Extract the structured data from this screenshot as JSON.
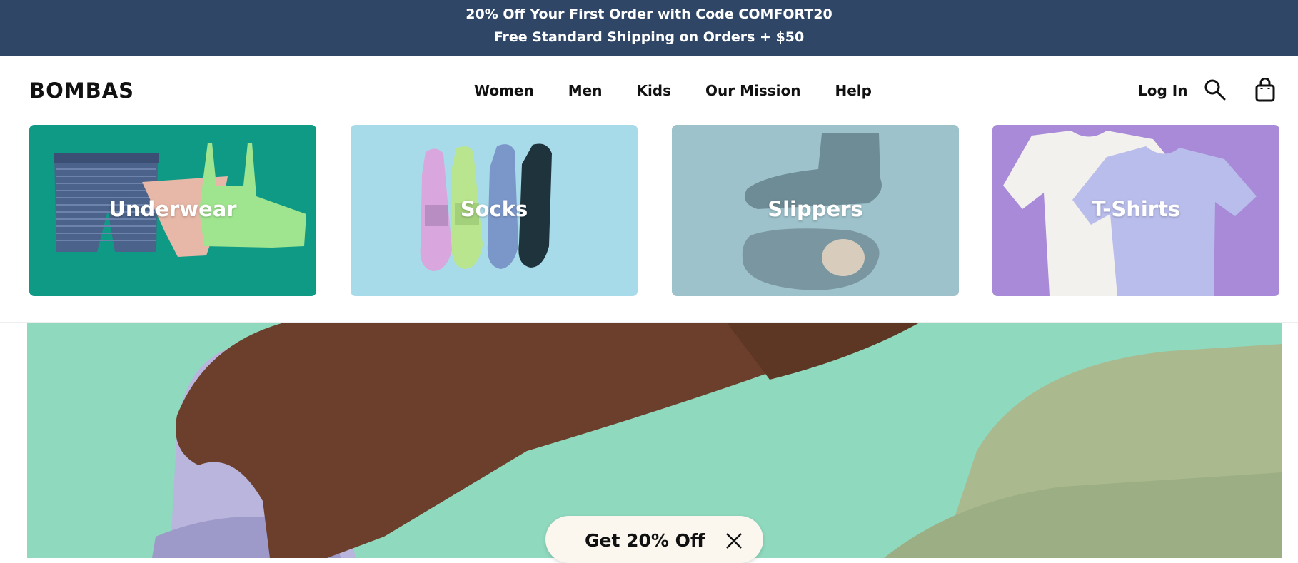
{
  "promo": {
    "line1": "20% Off Your First Order with Code COMFORT20",
    "line2": "Free Standard Shipping on Orders + $50"
  },
  "header": {
    "logo": "BOMBAS",
    "nav": [
      "Women",
      "Men",
      "Kids",
      "Our Mission",
      "Help"
    ],
    "login": "Log In",
    "search_icon": "search-icon",
    "bag_icon": "shopping-bag-icon"
  },
  "categories": [
    {
      "label": "Underwear",
      "bg": "#0f9a86"
    },
    {
      "label": "Socks",
      "bg": "#a8dbe9"
    },
    {
      "label": "Slippers",
      "bg": "#9dc2cb"
    },
    {
      "label": "T-Shirts",
      "bg": "#a98ad9"
    }
  ],
  "offer": {
    "label": "Get 20% Off",
    "close_icon": "close-icon"
  },
  "colors": {
    "promo_bg": "#2f4667",
    "hero_bg": "#8fd9bf",
    "offer_bg": "#fbf6ee"
  }
}
